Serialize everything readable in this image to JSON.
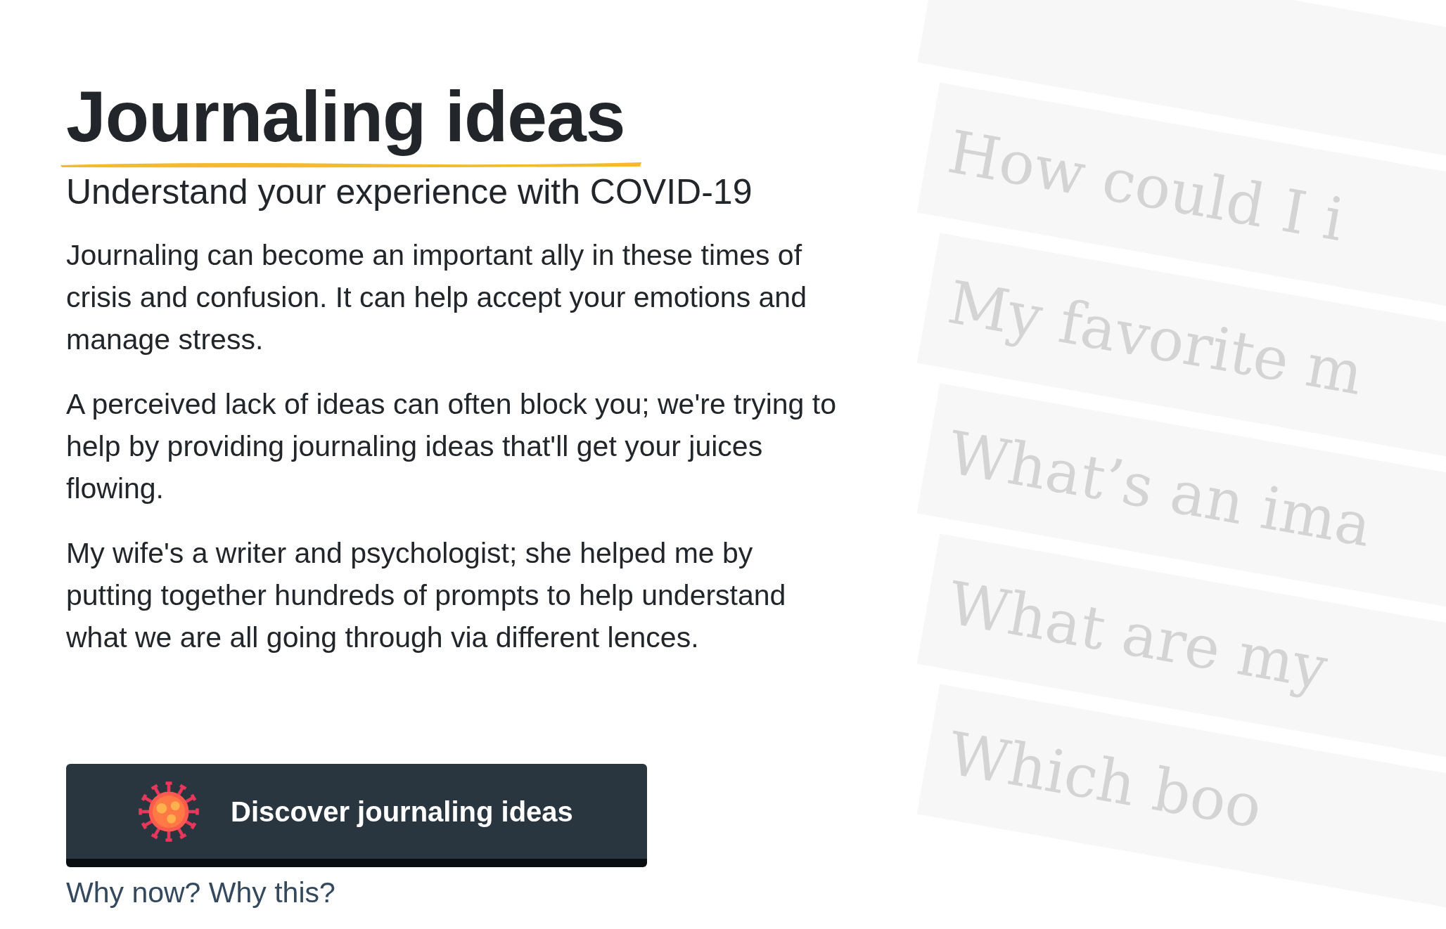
{
  "title": "Journaling ideas",
  "subtitle": "Understand your experience with COVID-19",
  "paragraphs": [
    "Journaling can become an important ally in these times of crisis and confusion. It can help accept your emotions and manage stress.",
    "A perceived lack of ideas can often block you; we're trying to help by providing journaling ideas that'll get your juices flowing.",
    "My wife's a writer and psychologist; she helped me by putting together hundreds of prompts to help understand what we are all going through via different lences."
  ],
  "cta_button": {
    "label": "Discover journaling ideas"
  },
  "link": "Why now? Why this?",
  "prompt_cards": [
    "How could I i",
    "My favorite m",
    "What’s an ima",
    "What are my",
    "Which boo"
  ]
}
